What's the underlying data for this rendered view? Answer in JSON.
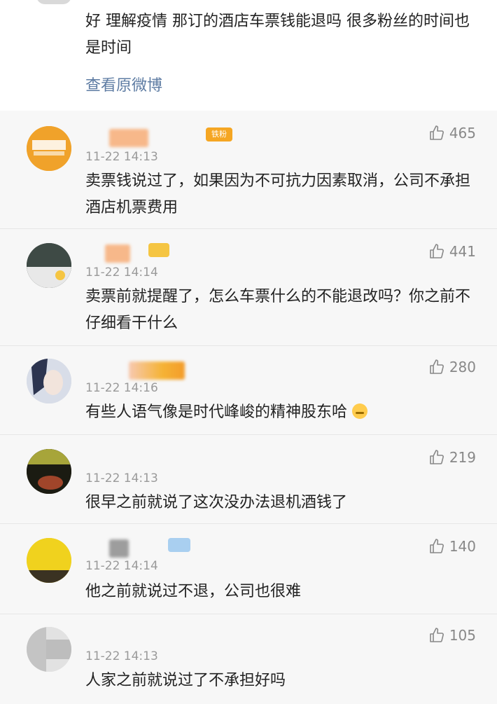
{
  "post": {
    "text": "好 理解疫情 那订的酒店车票钱能退吗 很多粉丝的时间也是时间",
    "view_original": "查看原微博"
  },
  "comments": [
    {
      "time": "11-22 14:13",
      "text": "卖票钱说过了，如果因为不可抗力因素取消，公司不承担酒店机票费用",
      "likes": "465",
      "badge": "铁粉"
    },
    {
      "time": "11-22 14:14",
      "text": "卖票前就提醒了，怎么车票什么的不能退改吗？你之前不仔细看干什么",
      "likes": "441"
    },
    {
      "time": "11-22 14:16",
      "text": "有些人语气像是时代峰峻的精神股东哈",
      "likes": "280"
    },
    {
      "time": "11-22 14:13",
      "text": "很早之前就说了这次没办法退机酒钱了",
      "likes": "219"
    },
    {
      "time": "11-22 14:14",
      "text": "他之前就说过不退，公司也很难",
      "likes": "140"
    },
    {
      "time": "11-22 14:13",
      "text": "人家之前就说过了不承担好吗",
      "likes": "105"
    }
  ],
  "colors": {
    "link": "#5e7ca3",
    "time": "#9a9a9a",
    "like": "#888888",
    "badge": "#f5a623"
  }
}
